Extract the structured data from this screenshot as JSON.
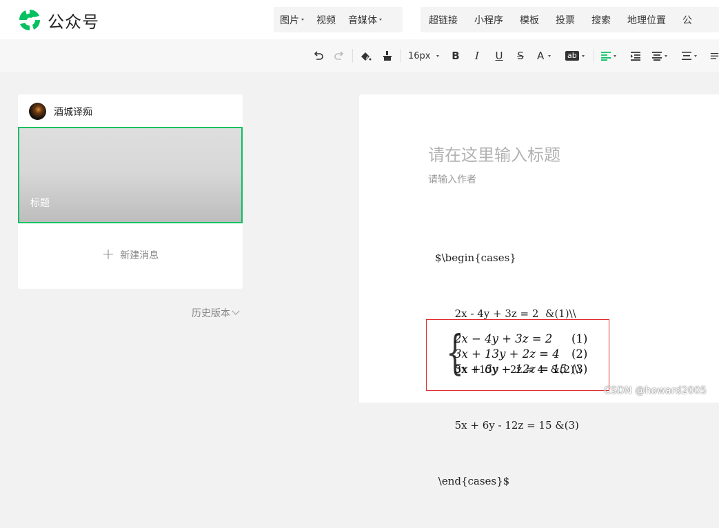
{
  "app": {
    "title": "公众号"
  },
  "insert_menu": {
    "group1": [
      "图片",
      "视频",
      "音媒体"
    ],
    "group1_has_caret": [
      true,
      false,
      true
    ],
    "group2": [
      "超链接",
      "小程序",
      "模板",
      "投票",
      "搜索",
      "地理位置",
      "公"
    ]
  },
  "toolbar": {
    "font_size": "16px",
    "icons": [
      "undo-icon",
      "redo-icon",
      "clear-format-icon",
      "format-painter-icon",
      "font-size-select",
      "bold-icon",
      "italic-icon",
      "underline-icon",
      "strikethrough-icon",
      "font-color-icon",
      "background-color-icon",
      "align-left-icon",
      "indent-icon",
      "text-align-icon",
      "line-spacing-icon",
      "more-icon"
    ],
    "labels": {
      "bold": "B",
      "italic": "I",
      "underline": "U",
      "strike": "S",
      "font_color": "A",
      "bg_color": "ab"
    }
  },
  "sidebar": {
    "account_name": "酒城译痴",
    "article_title": "标题",
    "new_message": "新建消息",
    "history": "历史版本"
  },
  "editor": {
    "title_placeholder": "请在这里输入标题",
    "author_placeholder": "请输入作者",
    "code_lines": [
      "$\\begin{cases}",
      "      2x - 4y + 3z = 2  &(1)\\\\",
      "      3x +13y +2z = 4  &(2)\\\\",
      "      5x + 6y - 12z = 15 &(3)",
      " \\end{cases}$"
    ],
    "formula_rows": [
      "2x − 4y + 3z = 2",
      "3x + 13y + 2z = 4",
      "5x + 6y − 12z = 15"
    ],
    "formula_numbers": [
      "(1)",
      "(2)",
      "(3)"
    ]
  },
  "watermark": "CSDN @howard2005",
  "colors": {
    "brand_green": "#07c160",
    "highlight_red": "#e02c2c"
  }
}
